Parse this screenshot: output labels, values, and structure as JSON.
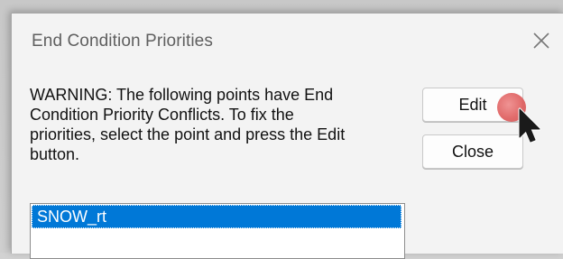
{
  "dialog": {
    "title": "End Condition Priorities",
    "close_icon": "close-icon",
    "warning_text": "WARNING:  The following points have End\nCondition Priority Conflicts.  To fix the\npriorities, select the point and press the Edit\nbutton.",
    "buttons": {
      "edit_label": "Edit",
      "close_label": "Close"
    },
    "list": {
      "items": [
        {
          "label": "SNOW_rt",
          "selected": true
        }
      ]
    }
  },
  "colors": {
    "selection": "#0078d7",
    "cursor_highlight": "#df5f5f"
  },
  "icons": {
    "close": "close-icon",
    "cursor": "mouse-pointer-icon"
  }
}
